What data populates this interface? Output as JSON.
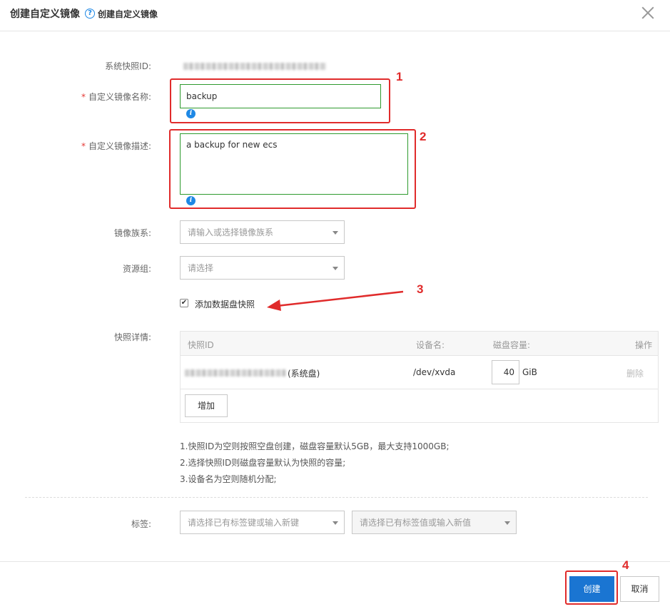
{
  "dialog": {
    "title": "创建自定义镜像",
    "help_glyph": "?",
    "help_text": "创建自定义镜像",
    "close_icon": "close-icon"
  },
  "form": {
    "snapshot_id": {
      "label": "系统快照ID:"
    },
    "name": {
      "required_mark": "*",
      "label": "自定义镜像名称:",
      "value": "backup"
    },
    "description": {
      "required_mark": "*",
      "label": "自定义镜像描述:",
      "value": "a backup for new ecs"
    },
    "info_glyph": "i",
    "family": {
      "label": "镜像族系:",
      "placeholder": "请输入或选择镜像族系"
    },
    "resource_group": {
      "label": "资源组:",
      "placeholder": "请选择"
    },
    "add_data_disk": {
      "checked": true,
      "check_glyph": "✔",
      "label": "添加数据盘快照"
    },
    "snapshot_details": {
      "label": "快照详情:",
      "columns": [
        "快照ID",
        "设备名:",
        "磁盘容量:",
        "操作"
      ],
      "rows": [
        {
          "snapshot_suffix": "(系统盘)",
          "device": "/dev/xvda",
          "size": "40",
          "unit": "GiB",
          "action": "删除"
        }
      ],
      "add_button": "增加"
    },
    "notes": [
      "1.快照ID为空则按照空盘创建，磁盘容量默认5GB，最大支持1000GB;",
      "2.选择快照ID则磁盘容量默认为快照的容量;",
      "3.设备名为空则随机分配;"
    ],
    "tags": {
      "label": "标签:",
      "key_placeholder": "请选择已有标签键或输入新键",
      "value_placeholder": "请选择已有标签值或输入新值"
    }
  },
  "footer": {
    "create_label": "创建",
    "cancel_label": "取消"
  },
  "annotations": [
    "1",
    "2",
    "3",
    "4"
  ],
  "colors": {
    "accent": "#1a75d2",
    "annotation": "#e02b2b",
    "valid_border": "#2e9a2e"
  }
}
